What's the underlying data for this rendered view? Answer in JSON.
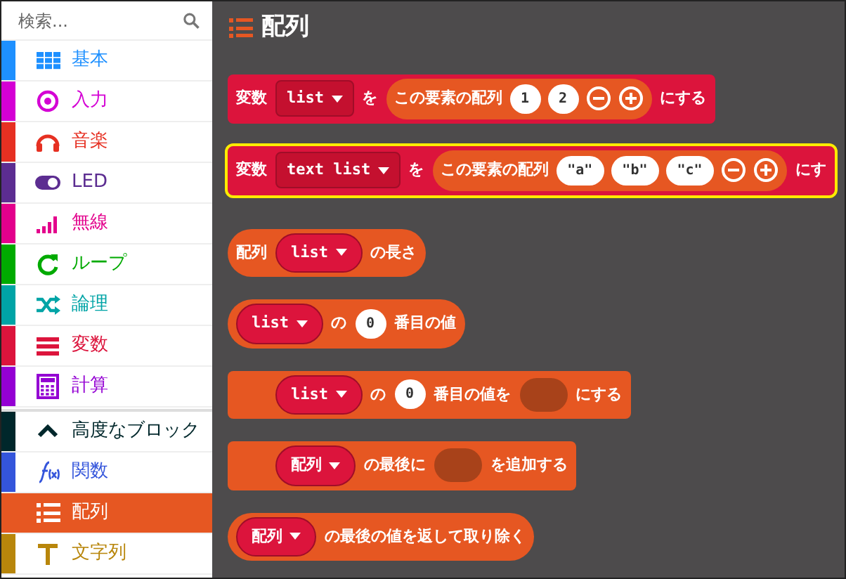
{
  "sidebar": {
    "search": {
      "placeholder": "検索..."
    },
    "categories": [
      {
        "label": "基本",
        "color": "#1e90ff",
        "selected": false
      },
      {
        "label": "入力",
        "color": "#d400d4",
        "selected": false
      },
      {
        "label": "音楽",
        "color": "#e63022",
        "selected": false
      },
      {
        "label": "LED",
        "color": "#5c2d91",
        "selected": false
      },
      {
        "label": "無線",
        "color": "#e3008c",
        "selected": false
      },
      {
        "label": "ループ",
        "color": "#00aa00",
        "selected": false
      },
      {
        "label": "論理",
        "color": "#00a4a6",
        "selected": false
      },
      {
        "label": "変数",
        "color": "#dc143c",
        "selected": false
      },
      {
        "label": "計算",
        "color": "#9400d3",
        "selected": false
      }
    ],
    "advanced": [
      {
        "label": "高度なブロック",
        "color": "#00272b",
        "selected": false
      },
      {
        "label": "関数",
        "color": "#3455db",
        "selected": false
      },
      {
        "label": "配列",
        "color": "#e65722",
        "selected": true
      },
      {
        "label": "文字列",
        "color": "#b8860b",
        "selected": false
      }
    ]
  },
  "workspace": {
    "title": "配列",
    "blocks": [
      {
        "kind": "statement",
        "color": "#dc143c",
        "selected": false,
        "parts": [
          {
            "kind": "text",
            "text": "変数"
          },
          {
            "kind": "dropdown",
            "text": "list"
          },
          {
            "kind": "text",
            "text": "を"
          },
          {
            "kind": "reporter",
            "parts": [
              {
                "kind": "text",
                "text": "この要素の配列"
              },
              {
                "kind": "number",
                "text": "1"
              },
              {
                "kind": "number",
                "text": "2"
              },
              {
                "kind": "minus"
              },
              {
                "kind": "plus"
              }
            ]
          },
          {
            "kind": "text",
            "text": "にする"
          }
        ]
      },
      {
        "kind": "statement",
        "color": "#dc143c",
        "selected": true,
        "parts": [
          {
            "kind": "text",
            "text": "変数"
          },
          {
            "kind": "dropdown",
            "text": "text list"
          },
          {
            "kind": "text",
            "text": "を"
          },
          {
            "kind": "reporter",
            "parts": [
              {
                "kind": "text",
                "text": "この要素の配列"
              },
              {
                "kind": "string",
                "text": "\"a\""
              },
              {
                "kind": "string",
                "text": "\"b\""
              },
              {
                "kind": "string",
                "text": "\"c\""
              },
              {
                "kind": "minus"
              },
              {
                "kind": "plus"
              }
            ]
          },
          {
            "kind": "text",
            "text": "にす"
          }
        ]
      },
      {
        "kind": "reporter",
        "color": "#e65722",
        "selected": false,
        "parts": [
          {
            "kind": "text",
            "text": "配列"
          },
          {
            "kind": "variable",
            "text": "list"
          },
          {
            "kind": "text",
            "text": "の長さ"
          }
        ]
      },
      {
        "kind": "reporter",
        "color": "#e65722",
        "selected": false,
        "parts": [
          {
            "kind": "variable",
            "text": "list"
          },
          {
            "kind": "text",
            "text": "の"
          },
          {
            "kind": "number",
            "text": "0"
          },
          {
            "kind": "text",
            "text": "番目の値"
          }
        ]
      },
      {
        "kind": "statement",
        "color": "#e65722",
        "selected": false,
        "parts": [
          {
            "kind": "variable",
            "text": "list"
          },
          {
            "kind": "text",
            "text": "の"
          },
          {
            "kind": "number",
            "text": "0"
          },
          {
            "kind": "text",
            "text": "番目の値を"
          },
          {
            "kind": "slot"
          },
          {
            "kind": "text",
            "text": "にする"
          }
        ]
      },
      {
        "kind": "statement",
        "color": "#e65722",
        "selected": false,
        "parts": [
          {
            "kind": "variable",
            "text": "配列"
          },
          {
            "kind": "text",
            "text": "の最後に"
          },
          {
            "kind": "slot"
          },
          {
            "kind": "text",
            "text": "を追加する"
          }
        ]
      },
      {
        "kind": "reporter",
        "color": "#e65722",
        "selected": false,
        "parts": [
          {
            "kind": "variable",
            "text": "配列"
          },
          {
            "kind": "text",
            "text": "の最後の値を返して取り除く"
          }
        ]
      }
    ]
  }
}
